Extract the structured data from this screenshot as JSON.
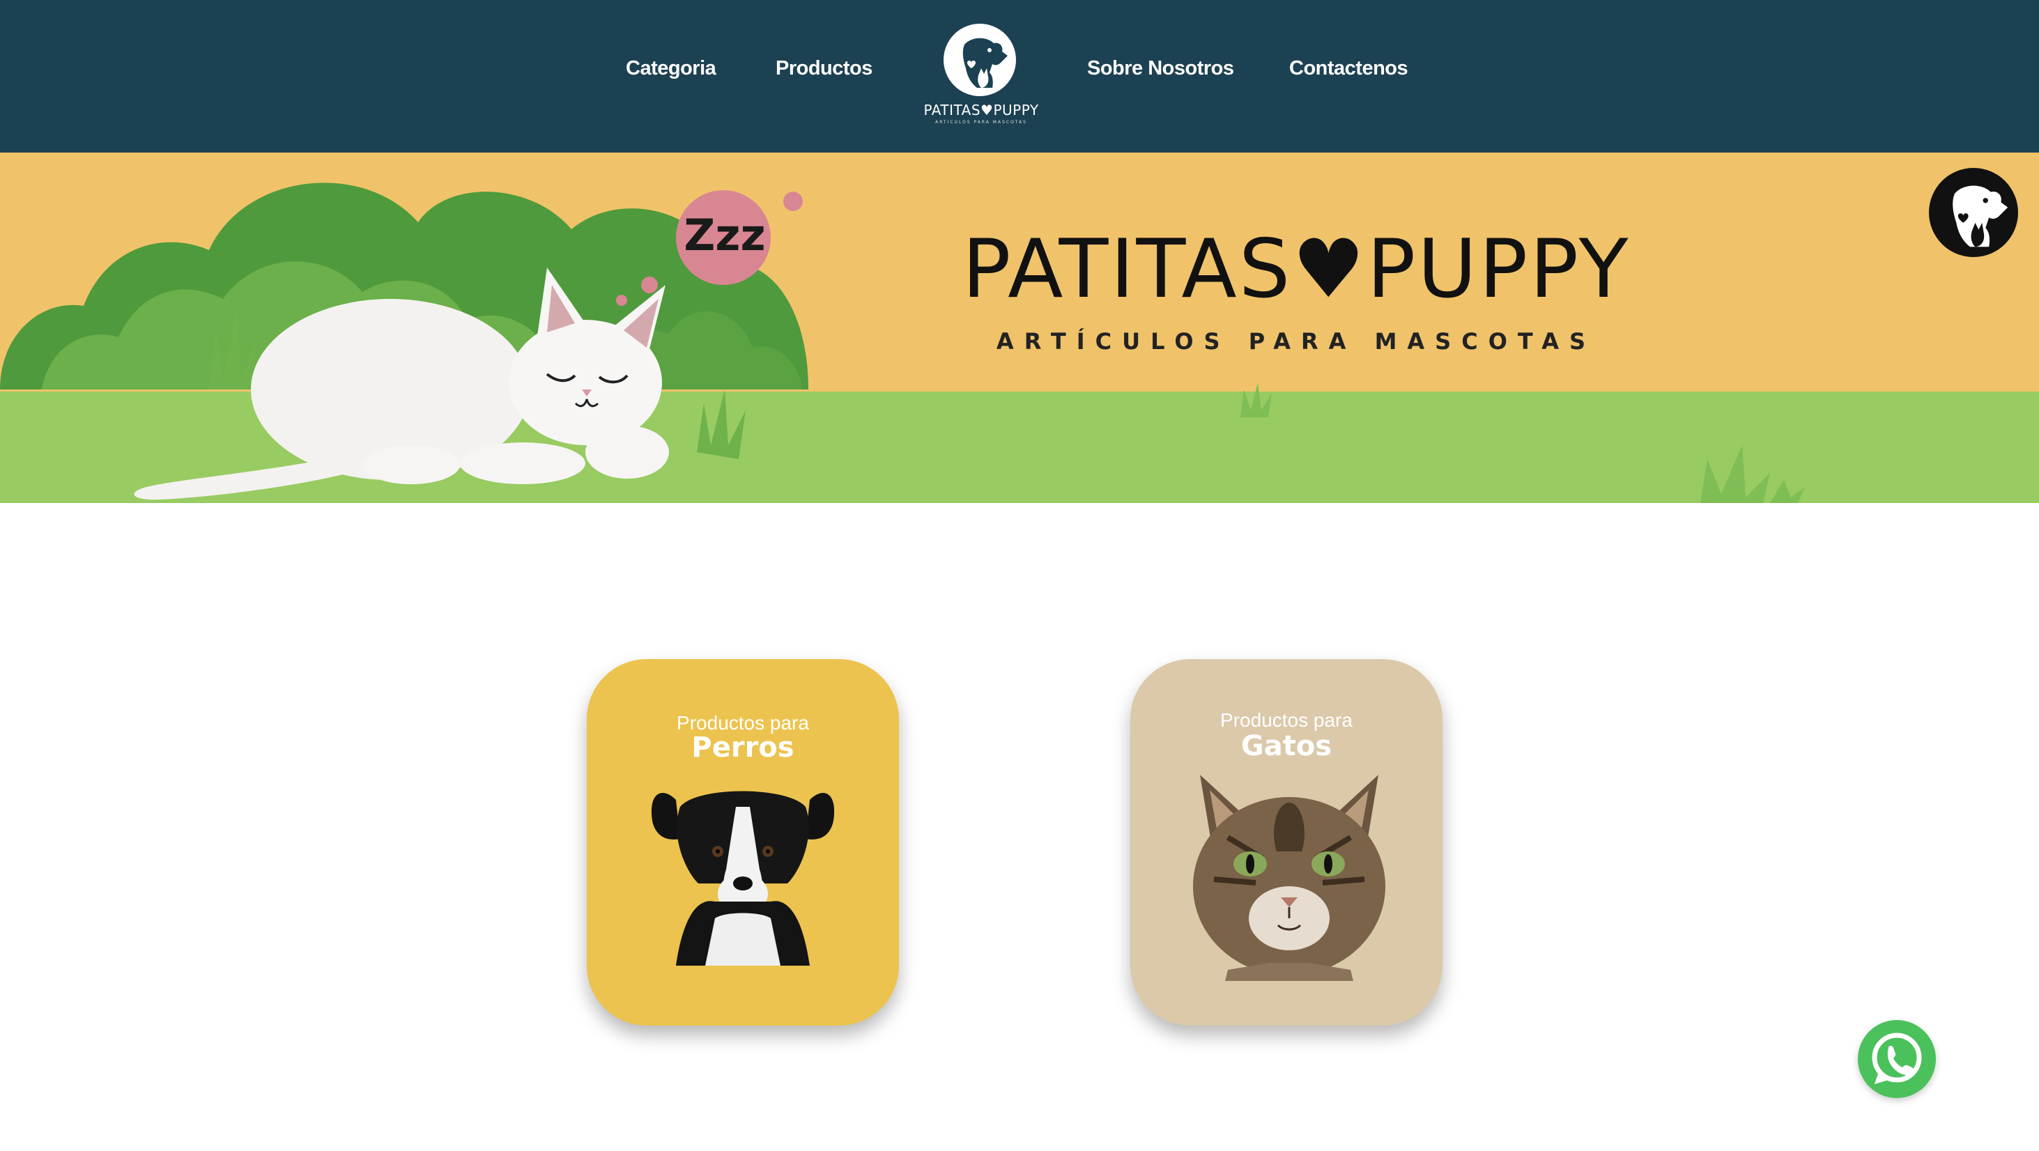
{
  "nav": {
    "links": [
      "Categoria",
      "Productos",
      "Sobre Nosotros",
      "Contactenos"
    ],
    "logo": {
      "name": "PATITAS♥PUPPY",
      "tagline": "ARTÍCULOS PARA MASCOTAS"
    }
  },
  "banner": {
    "title": "PATITAS♥PUPPY",
    "subtitle": "ARTÍCULOS PARA MASCOTAS",
    "bubble_text": "Zzz"
  },
  "cards": [
    {
      "pre": "Productos para",
      "main": "Perros",
      "image": "dog-photo",
      "color": "#ecc34e"
    },
    {
      "pre": "Productos para",
      "main": "Gatos",
      "image": "cat-photo",
      "color": "#dbc9aa"
    }
  ],
  "colors": {
    "header": "#1c4152",
    "banner": "#f0c36a",
    "grass": "#98cb62",
    "whatsapp": "#4ac15a"
  },
  "icons": [
    "dog-cat-logo-icon",
    "whatsapp-icon"
  ]
}
